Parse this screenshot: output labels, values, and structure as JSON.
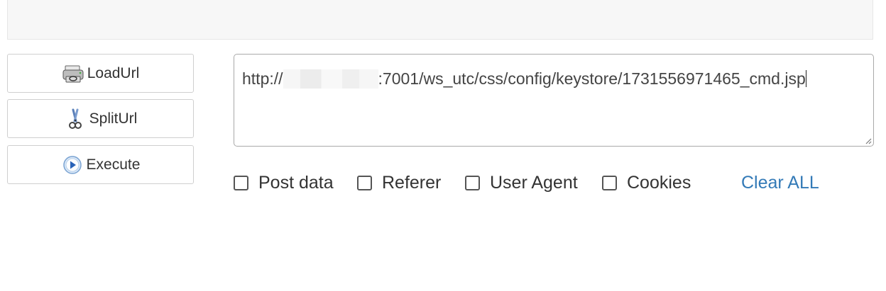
{
  "buttons": {
    "load_url": "LoadUrl",
    "split_url": "SplitUrl",
    "execute": "Execute"
  },
  "url_field": {
    "prefix": "http://",
    "value_after_redaction": ":7001/ws_utc/css/config/keystore/1731556971465_cmd.jsp"
  },
  "options": {
    "post_data": "Post data",
    "referer": "Referer",
    "user_agent": "User Agent",
    "cookies": "Cookies"
  },
  "clear_all": "Clear ALL",
  "icons": {
    "load_url": "printer-load-icon",
    "split_url": "scissors-icon",
    "execute": "play-circle-icon"
  },
  "colors": {
    "link": "#337ab7",
    "border": "#cfcfcf",
    "panel": "#f7f7f7"
  }
}
